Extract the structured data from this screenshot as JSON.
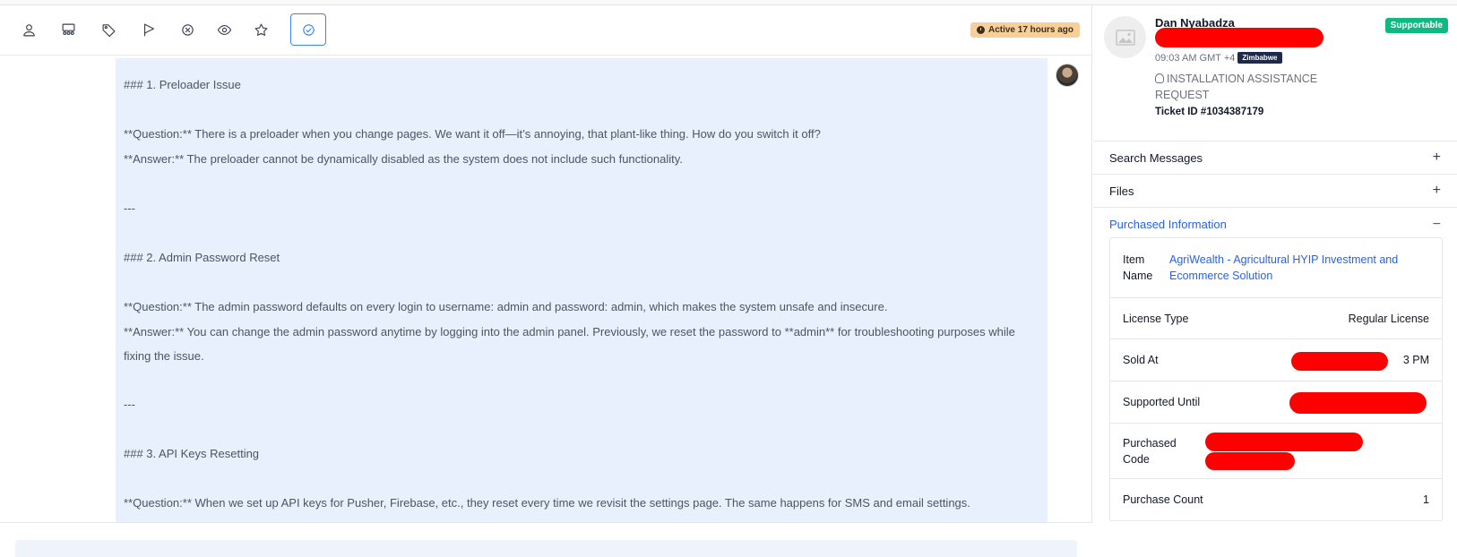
{
  "toolbar": {
    "buttons": [
      {
        "icon": "user-icon"
      },
      {
        "icon": "group-icon"
      },
      {
        "icon": "tag-icon"
      },
      {
        "icon": "flag-icon"
      },
      {
        "icon": "close-circle-icon"
      },
      {
        "icon": "eye-icon"
      },
      {
        "icon": "star-icon"
      },
      {
        "icon": "check-circle-icon",
        "active": true
      }
    ],
    "active_badge": "Active 17 hours ago"
  },
  "message": {
    "lines": [
      "### 1. Preloader Issue",
      "",
      "**Question:** There is a preloader when you change pages. We want it off—it’s annoying, that plant-like thing. How do you switch it off?",
      "**Answer:** The preloader cannot be dynamically disabled as the system does not include such functionality.",
      "",
      "---",
      "",
      "### 2. Admin Password Reset",
      "",
      "**Question:** The admin password defaults on every login to username: admin and password: admin, which makes the system unsafe and insecure.",
      "**Answer:** You can change the admin password anytime by logging into the admin panel. Previously, we reset the password to **admin** for troubleshooting purposes while fixing the issue.",
      "",
      "---",
      "",
      "### 3. API Keys Resetting",
      "",
      "**Question:** When we set up API keys for Pusher, Firebase, etc., they reset every time we revisit the settings page. The same happens for SMS and email settings."
    ]
  },
  "profile": {
    "name": "Dan Nyabadza",
    "time": "09:03 AM GMT +4",
    "country": "Zimbabwe",
    "request": "INSTALLATION ASSISTANCE REQUEST",
    "ticket": "Ticket ID #1034387179",
    "status_badge": "Supportable"
  },
  "accordions": [
    {
      "label": "Search Messages",
      "sign": "+"
    },
    {
      "label": "Files",
      "sign": "+"
    },
    {
      "label": "Purchased Information",
      "sign": "−"
    }
  ],
  "purchase": {
    "item_label": "Item Name",
    "item_value": "AgriWealth - Agricultural HYIP Investment and Ecommerce Solution",
    "license_label": "License Type",
    "license_value": "Regular License",
    "sold_label": "Sold At",
    "sold_value_visible": "3 PM",
    "supported_label": "Supported Until",
    "code_label": "Purchased Code",
    "count_label": "Purchase Count",
    "count_value": "1"
  },
  "colors": {
    "accent": "#2563eb",
    "bubble": "#e8f0fd",
    "badge_active": "#f6cf99",
    "badge_supportable": "#10b981",
    "redaction": "#ff0000"
  }
}
